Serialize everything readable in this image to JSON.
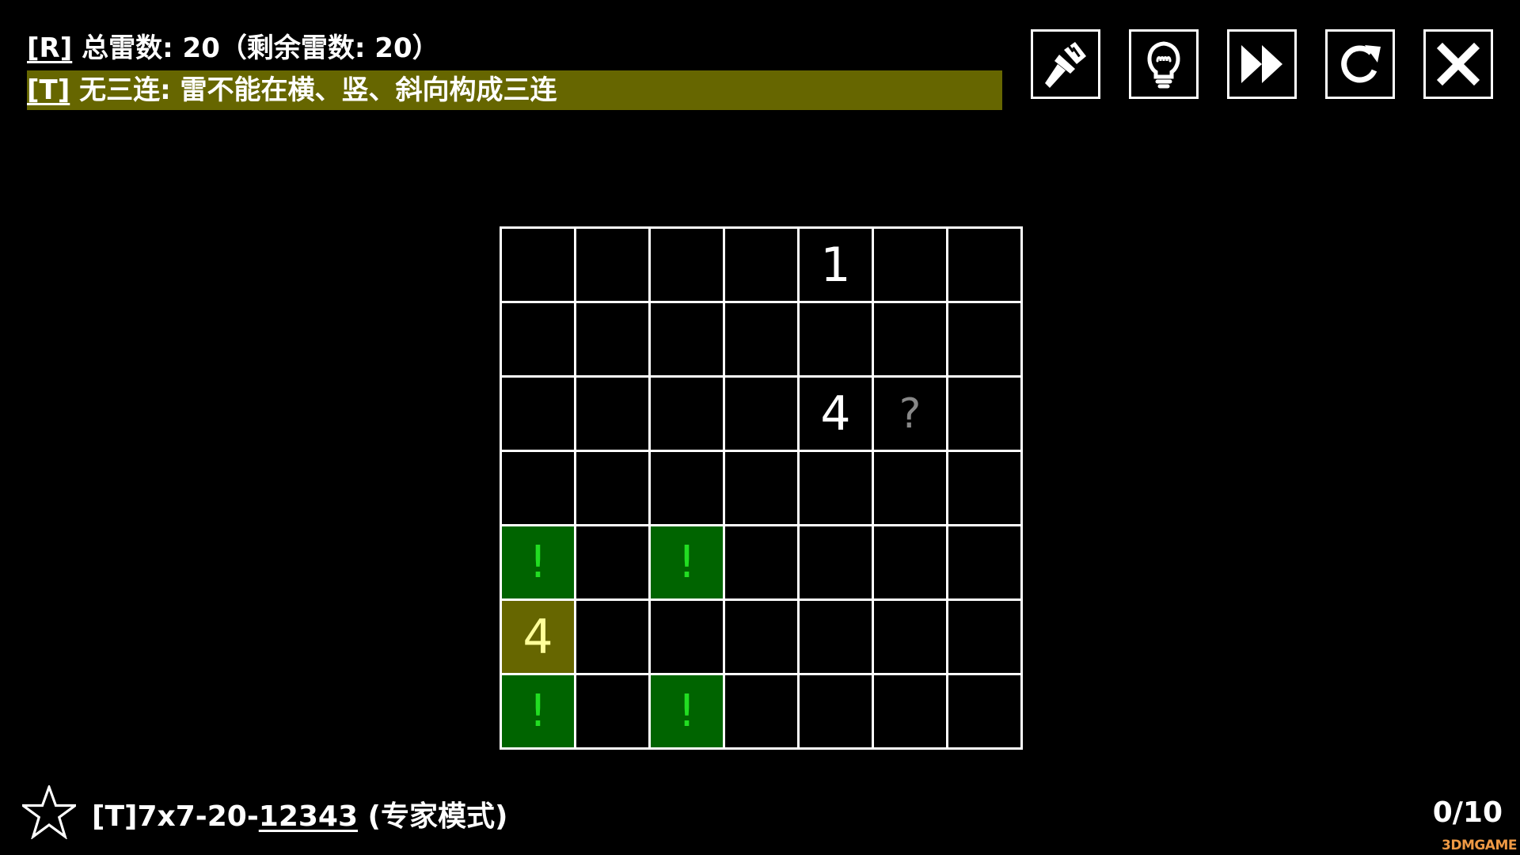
{
  "rules": {
    "line1": {
      "key": "[R]",
      "text": " 总雷数:  20（剩余雷数: 20）"
    },
    "line2": {
      "key": "[T]",
      "text": " 无三连: 雷不能在横、竖、斜向构成三连"
    },
    "highlight_color": "#666600"
  },
  "toolbar": [
    {
      "name": "paint-button",
      "icon": "brush-icon"
    },
    {
      "name": "hint-button",
      "icon": "lightbulb-icon"
    },
    {
      "name": "skip-button",
      "icon": "fast-forward-icon"
    },
    {
      "name": "restart-button",
      "icon": "restart-icon"
    },
    {
      "name": "close-button",
      "icon": "close-icon"
    }
  ],
  "board": {
    "size": 7,
    "rows": [
      [
        "",
        "",
        "",
        "",
        "1",
        "",
        ""
      ],
      [
        "",
        "",
        "",
        "",
        "",
        "",
        ""
      ],
      [
        "",
        "",
        "",
        "",
        "4",
        "?",
        ""
      ],
      [
        "",
        "",
        "",
        "",
        "",
        "",
        ""
      ],
      [
        "!",
        "",
        "!",
        "",
        "",
        "",
        ""
      ],
      [
        "4",
        "",
        "",
        "",
        "",
        "",
        ""
      ],
      [
        "!",
        "",
        "!",
        "",
        "",
        "",
        ""
      ]
    ],
    "highlight_cells": [
      [
        5,
        0
      ]
    ],
    "colors": {
      "flag_bg": "#006400",
      "flag_fg": "#22dd22",
      "highlight_bg": "#666600",
      "highlight_fg": "#ffff99",
      "unknown_fg": "#888888"
    }
  },
  "footer": {
    "level_prefix": "[T]7x7-20-",
    "level_id": "12343",
    "level_mode": " (专家模式)",
    "progress": "0/10",
    "watermark": "3DMGAME"
  }
}
